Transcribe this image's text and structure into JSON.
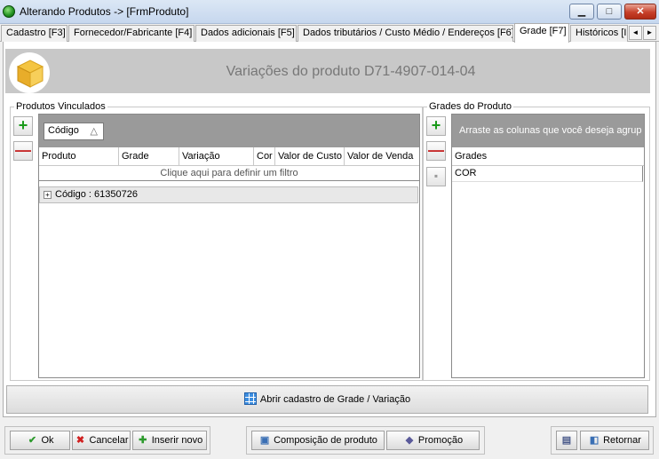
{
  "window": {
    "title": "Alterando Produtos  ->  [FrmProduto]",
    "controls": {
      "minimize": "▁",
      "maximize": "□",
      "close": "✕"
    }
  },
  "tabs": [
    {
      "label": "Cadastro [F3]",
      "active": false
    },
    {
      "label": "Fornecedor/Fabricante [F4]",
      "active": false
    },
    {
      "label": "Dados adicionais [F5]",
      "active": false
    },
    {
      "label": "Dados tributários / Custo Médio / Endereços [F6]",
      "active": false
    },
    {
      "label": "Grade [F7]",
      "active": true
    },
    {
      "label": "Históricos [I",
      "active": false
    }
  ],
  "tab_scroll": {
    "left": "◄",
    "right": "►"
  },
  "header": {
    "title": "Variações do produto D71-4907-014-04"
  },
  "produtos_vinculados": {
    "legend": "Produtos Vinculados",
    "add_label": "+",
    "remove_label": "—",
    "group_chip": {
      "label": "Código",
      "sort_glyph": "△"
    },
    "columns": [
      "Produto",
      "Grade",
      "Variação",
      "Cor",
      "Valor de Custo",
      "Valor de Venda"
    ],
    "filter_text": "Clique aqui para definir um filtro",
    "group_rows": [
      {
        "expander": "+",
        "text": "Código : 61350726"
      }
    ]
  },
  "grades_do_produto": {
    "legend": "Grades do Produto",
    "add_label": "+",
    "remove_label": "—",
    "disabled_label": "▪",
    "group_panel_text": "Arraste as colunas que você deseja agrup",
    "column": "Grades",
    "rows": [
      "COR"
    ]
  },
  "open_grade_button": {
    "label": "Abrir cadastro de Grade / Variação"
  },
  "footer": {
    "ok": {
      "icon": "✔",
      "label": "Ok"
    },
    "cancel": {
      "icon": "✖",
      "label": "Cancelar"
    },
    "insert": {
      "icon": "✚",
      "label": "Inserir novo"
    },
    "composicao": {
      "icon": "▣",
      "label": "Composição de produto"
    },
    "promocao": {
      "icon": "◆",
      "label": "Promoção"
    },
    "save_icon": "▤",
    "retornar": {
      "icon": "◧",
      "label": "Retornar"
    }
  }
}
